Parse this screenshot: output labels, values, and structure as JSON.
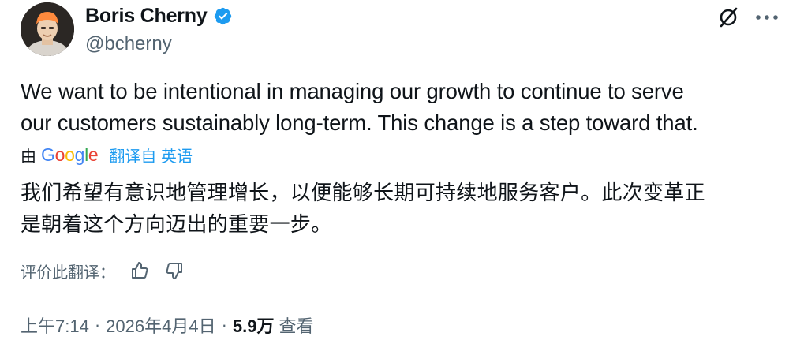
{
  "author": {
    "display_name": "Boris Cherny",
    "handle": "@bcherny",
    "verified": true
  },
  "icons": {
    "avatar": "avatar",
    "verified": "verified-badge-icon",
    "grok": "grok-icon",
    "more": "more-horizontal-icon",
    "thumbs_up": "thumbs-up-icon",
    "thumbs_down": "thumbs-down-icon"
  },
  "colors": {
    "text": "#0f1419",
    "secondary": "#536471",
    "accent": "#1d9bf0"
  },
  "tweet": {
    "text_line1": "We want to be intentional in managing our growth to continue to serve",
    "text_line2": "our customers sustainably long-term. This change is a step toward that."
  },
  "translation": {
    "by_prefix": "由",
    "provider": "Google",
    "translated_from": "翻译自 英语",
    "text_line1": "我们希望有意识地管理增长，以便能够长期可持续地服务客户。此次变革正",
    "text_line2": "是朝着这个方向迈出的重要一步。",
    "rate_label": "评价此翻译："
  },
  "meta": {
    "time": "上午7:14",
    "separator": "·",
    "date": "2026年4月4日",
    "views_count": "5.9万",
    "views_label": "查看"
  }
}
